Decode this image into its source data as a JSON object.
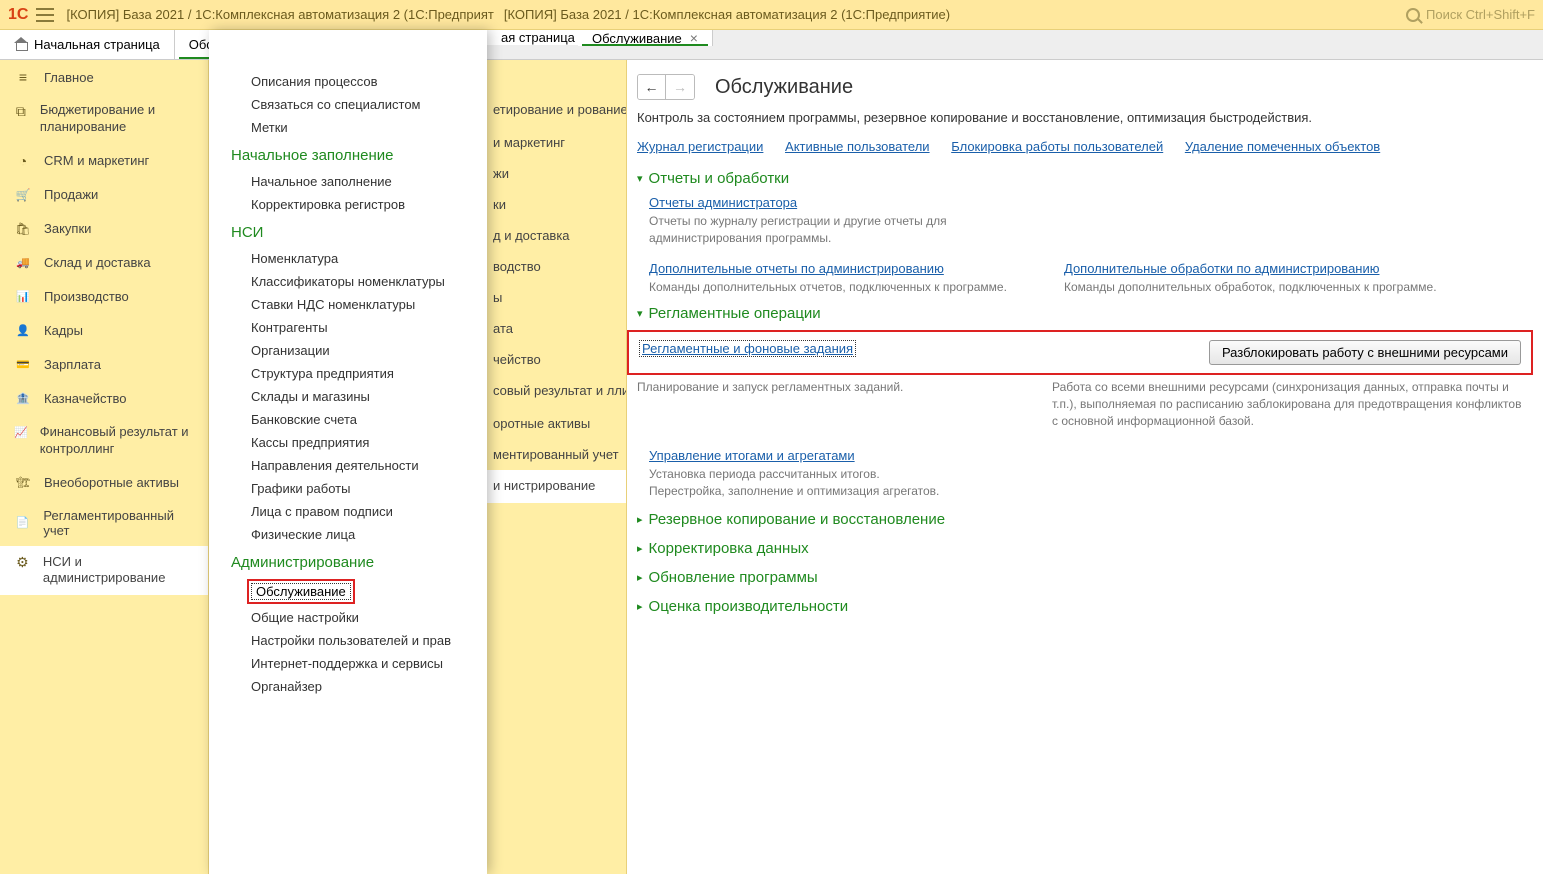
{
  "titlebar": {
    "title1": "[КОПИЯ] База 2021 / 1С:Комплексная автоматизация 2  (1С:Предприят",
    "title2": "[КОПИЯ] База 2021 / 1С:Комплексная автоматизация 2  (1С:Предприятие)",
    "search_placeholder": "Поиск Ctrl+Shift+F"
  },
  "tabs": {
    "home": "Начальная страница",
    "partial1": "Обслу",
    "partial2": "ая страница",
    "maint": "Обслуживание"
  },
  "nav1": {
    "items": [
      {
        "label": "Главное"
      },
      {
        "label": "Бюджетирование и планирование"
      },
      {
        "label": "CRM и маркетинг"
      },
      {
        "label": "Продажи"
      },
      {
        "label": "Закупки"
      },
      {
        "label": "Склад и доставка"
      },
      {
        "label": "Производство"
      },
      {
        "label": "Кадры"
      },
      {
        "label": "Зарплата"
      },
      {
        "label": "Казначейство"
      },
      {
        "label": "Финансовый результат и контроллинг"
      },
      {
        "label": "Внеоборотные активы"
      },
      {
        "label": "Регламентированный учет"
      },
      {
        "label": "НСИ и администрирование"
      }
    ]
  },
  "dropdown": {
    "top_links": [
      "Описания процессов",
      "Связаться со специалистом",
      "Метки"
    ],
    "sections": {
      "init": {
        "title": "Начальное заполнение",
        "items": [
          "Начальное заполнение",
          "Корректировка регистров"
        ]
      },
      "nsi": {
        "title": "НСИ",
        "items": [
          "Номенклатура",
          "Классификаторы номенклатуры",
          "Ставки НДС номенклатуры",
          "Контрагенты",
          "Организации",
          "Структура предприятия",
          "Склады и магазины",
          "Банковские счета",
          "Кассы предприятия",
          "Направления деятельности",
          "Графики работы",
          "Лица с правом подписи",
          "Физические лица"
        ]
      },
      "admin": {
        "title": "Администрирование",
        "items": [
          "Обслуживание",
          "Общие настройки",
          "Настройки пользователей и прав",
          "Интернет-поддержка и сервисы",
          "Органайзер"
        ]
      }
    }
  },
  "nav2": {
    "items": [
      "етирование и рование",
      "и маркетинг",
      "жи",
      "ки",
      "д и доставка",
      "водство",
      "ы",
      "ата",
      "чейство",
      "совый результат и ллинг",
      "оротные активы",
      "ментированный учет",
      "и нистрирование"
    ]
  },
  "content": {
    "title": "Обслуживание",
    "helptext": "Контроль за состоянием программы, резервное копирование и восстановление, оптимизация быстродействия.",
    "toplinks": [
      "Журнал регистрации",
      "Активные пользователи",
      "Блокировка работы пользователей",
      "Удаление помеченных объектов"
    ],
    "sec_reports": {
      "title": "Отчеты и обработки",
      "link1": "Отчеты администратора",
      "desc1": "Отчеты по журналу регистрации и другие отчеты для администрирования программы.",
      "link2": "Дополнительные отчеты по администрированию",
      "desc2": "Команды дополнительных отчетов, подключенных к программе.",
      "link3": "Дополнительные обработки по администрированию",
      "desc3": "Команды дополнительных обработок, подключенных к программе."
    },
    "sec_ops": {
      "title": "Регламентные операции",
      "link1": "Регламентные и фоновые задания",
      "desc1": "Планирование и запуск регламентных заданий.",
      "button": "Разблокировать работу с внешними ресурсами",
      "desc_right": "Работа со всеми внешними ресурсами (синхронизация данных, отправка почты и т.п.), выполняемая по расписанию заблокирована для предотвращения конфликтов с основной информационной базой.",
      "link2": "Управление итогами и агрегатами",
      "desc2a": "Установка периода рассчитанных итогов.",
      "desc2b": "Перестройка, заполнение и оптимизация агрегатов."
    },
    "collapsed": [
      "Резервное копирование и восстановление",
      "Корректировка данных",
      "Обновление программы",
      "Оценка производительности"
    ]
  }
}
